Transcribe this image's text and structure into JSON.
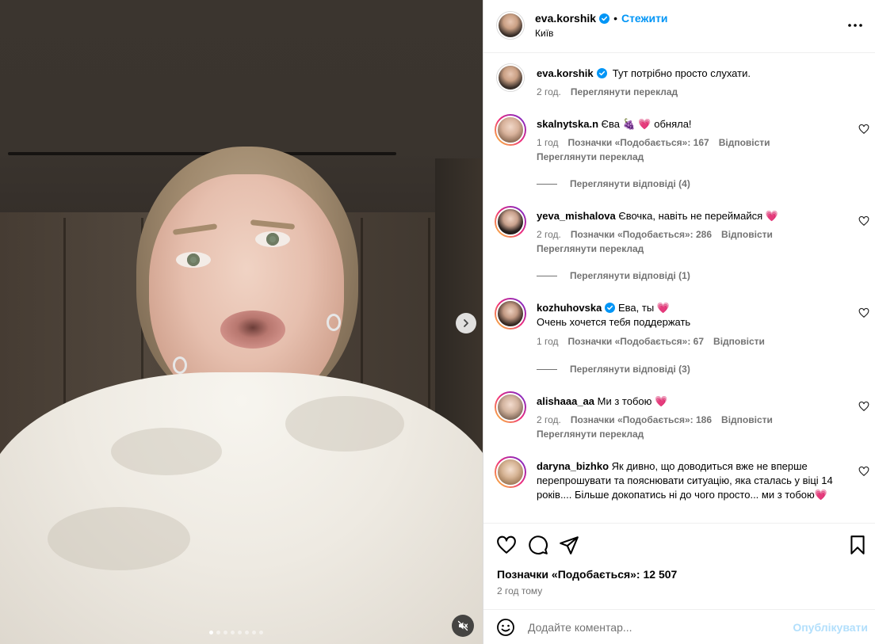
{
  "post": {
    "author": "eva.korshik",
    "follow_label": "Стежити",
    "location": "Київ",
    "caption": "Тут потрібно просто слухати.",
    "caption_time": "2 год.",
    "caption_translate": "Переглянути переклад",
    "likes_label": "Позначки «Подобається»: 12 507",
    "posted_ago": "2 год тому",
    "comment_placeholder": "Додайте коментар...",
    "publish_label": "Опублікувати",
    "more_icon": "more-horizontal-icon",
    "carousel_slides": 8,
    "carousel_active": 1
  },
  "comments": [
    {
      "user": "skalnytska.n",
      "text": "Єва 🍇 💗 обняла!",
      "time": "1 год",
      "likes": "Позначки «Подобається»: 167",
      "reply": "Відповісти",
      "translate": "Переглянути переклад",
      "view_replies": "Переглянути відповіді (4)",
      "verified": false
    },
    {
      "user": "yeva_mishalova",
      "text": "Євочка, навіть не переймайся 💗",
      "time": "2 год.",
      "likes": "Позначки «Подобається»: 286",
      "reply": "Відповісти",
      "translate": "Переглянути переклад",
      "view_replies": "Переглянути відповіді (1)",
      "verified": false
    },
    {
      "user": "kozhuhovska",
      "text": "Ева, ты 💗",
      "text2": "Очень хочется тебя поддержать",
      "time": "1 год",
      "likes": "Позначки «Подобається»: 67",
      "reply": "Відповісти",
      "view_replies": "Переглянути відповіді (3)",
      "verified": true
    },
    {
      "user": "alishaaa_aa",
      "text": "Ми з тобою 💗",
      "time": "2 год.",
      "likes": "Позначки «Подобається»: 186",
      "reply": "Відповісти",
      "translate": "Переглянути переклад",
      "verified": false
    },
    {
      "user": "daryna_bizhko",
      "text": "Як дивно, що доводиться вже не вперше перепрошувати та пояснювати ситуацію, яка сталась у віці 14 років.... Більше докопатись ні до чого просто... ми з тобою💗",
      "verified": false
    }
  ],
  "colors": {
    "accent": "#0095f6",
    "muted": "#737373",
    "publish_disabled": "#b2dffc",
    "heart": "#e8376b"
  }
}
